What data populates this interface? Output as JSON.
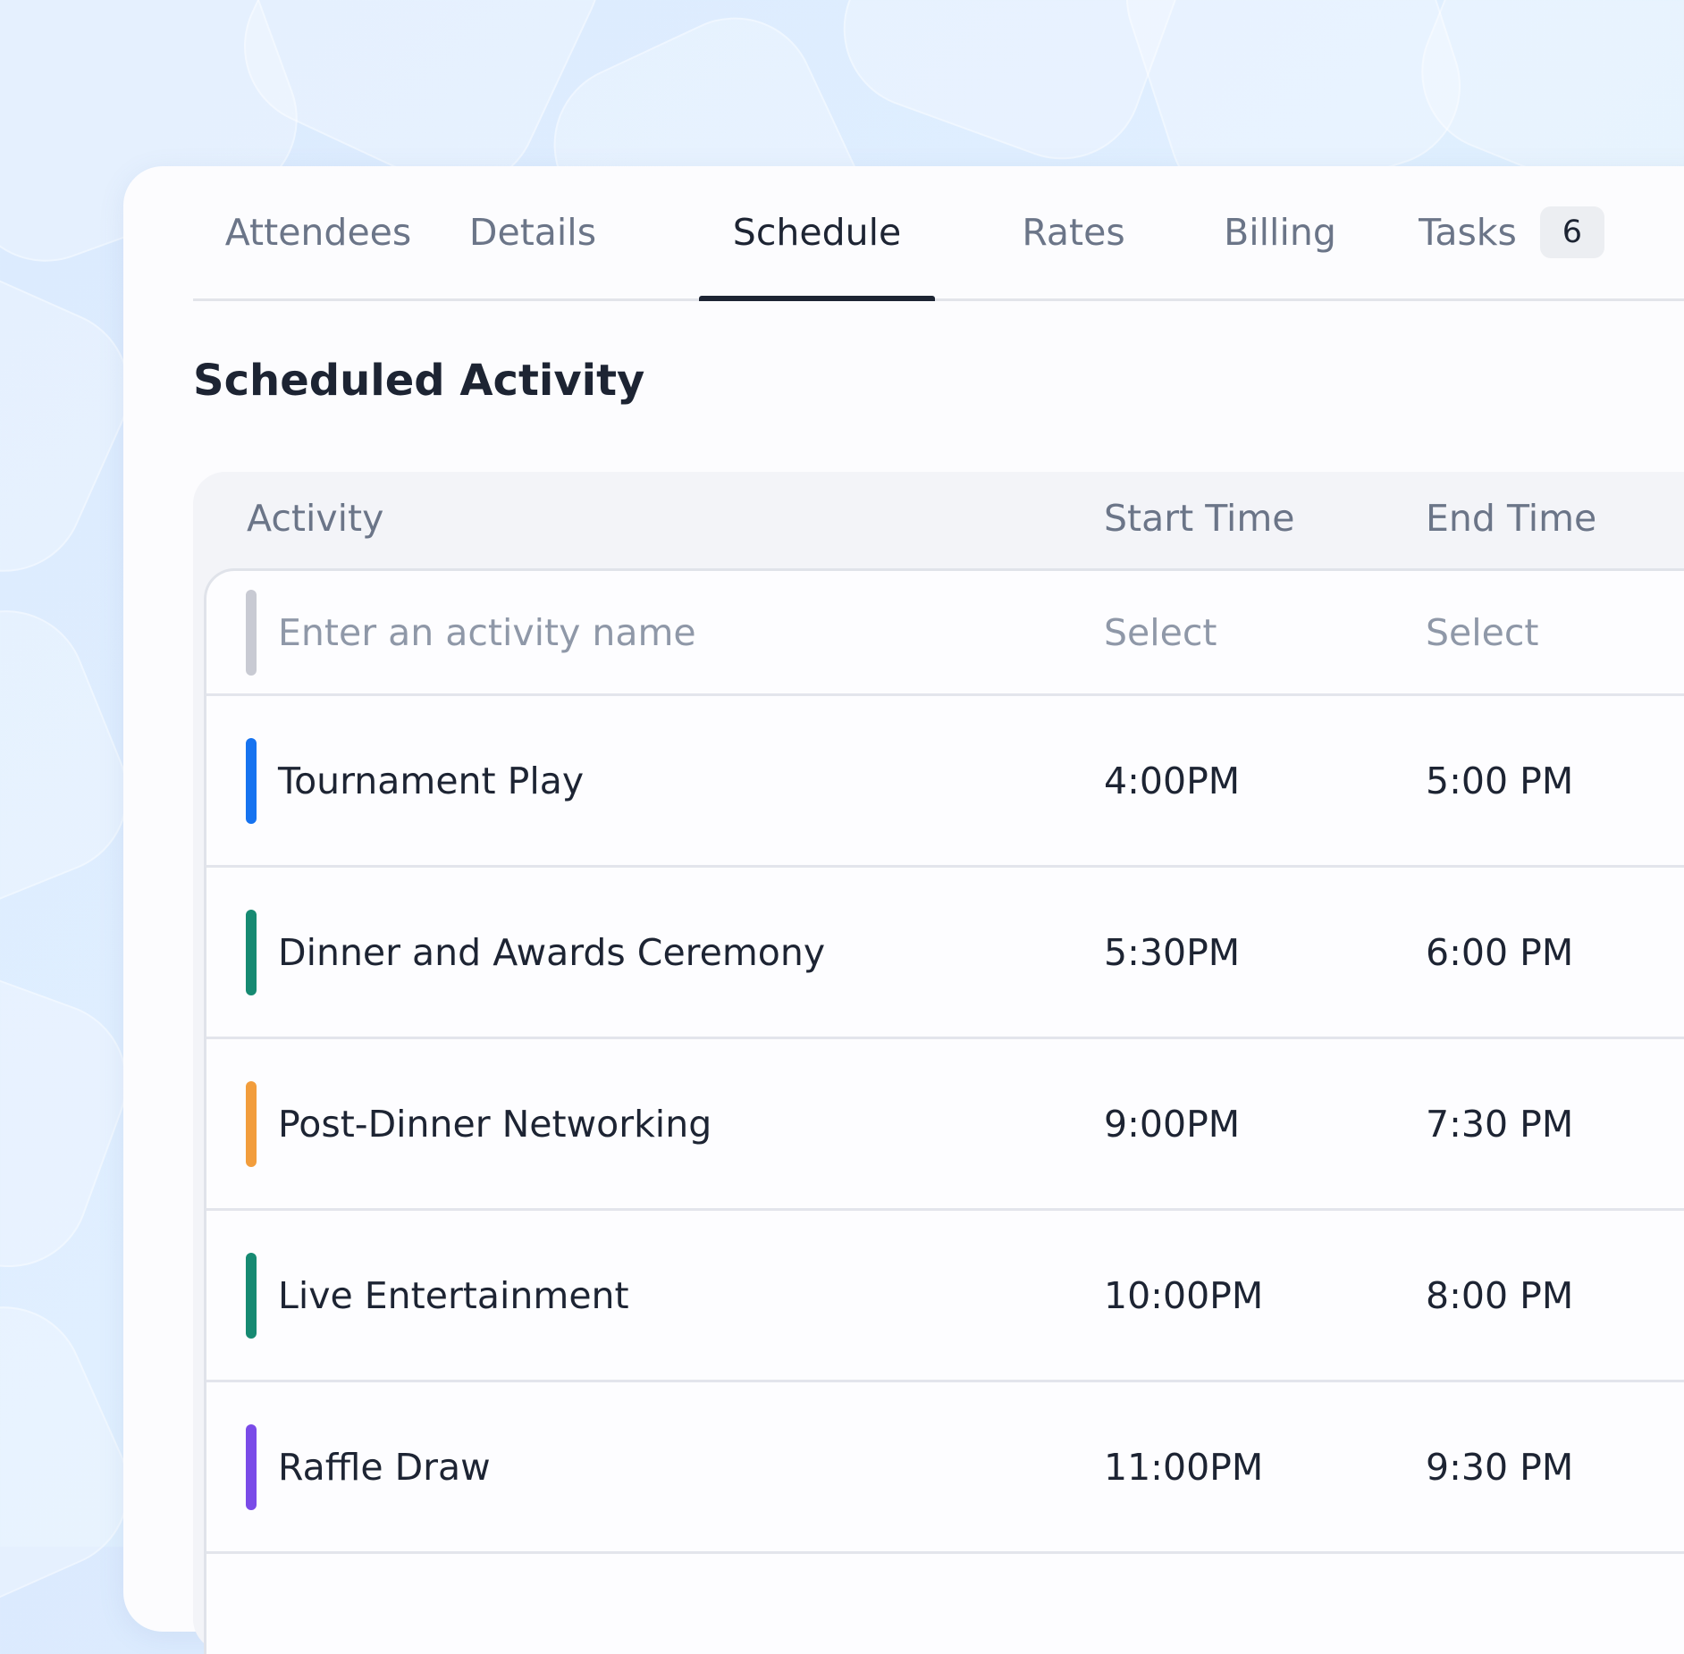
{
  "tabs": [
    {
      "label": "Attendees"
    },
    {
      "label": "Details"
    },
    {
      "label": "Schedule",
      "active": true
    },
    {
      "label": "Rates"
    },
    {
      "label": "Billing"
    },
    {
      "label": "Tasks",
      "badge": "6"
    }
  ],
  "section_title": "Scheduled Activity",
  "table": {
    "headers": {
      "activity": "Activity",
      "start": "Start Time",
      "end": "End Time"
    },
    "new_row": {
      "activity_placeholder": "Enter an activity name",
      "start_placeholder": "Select",
      "end_placeholder": "Select",
      "marker_color": "#c8cad3"
    },
    "rows": [
      {
        "activity": "Tournament Play",
        "start": "4:00PM",
        "end": "5:00 PM",
        "color": "#1673f0"
      },
      {
        "activity": "Dinner and Awards Ceremony",
        "start": "5:30PM",
        "end": "6:00 PM",
        "color": "#168a72"
      },
      {
        "activity": "Post-Dinner Networking",
        "start": "9:00PM",
        "end": "7:30 PM",
        "color": "#f29d3c"
      },
      {
        "activity": "Live Entertainment",
        "start": "10:00PM",
        "end": "8:00 PM",
        "color": "#168a72"
      },
      {
        "activity": "Raffle Draw",
        "start": "11:00PM",
        "end": "9:30 PM",
        "color": "#7a4be8"
      }
    ]
  }
}
